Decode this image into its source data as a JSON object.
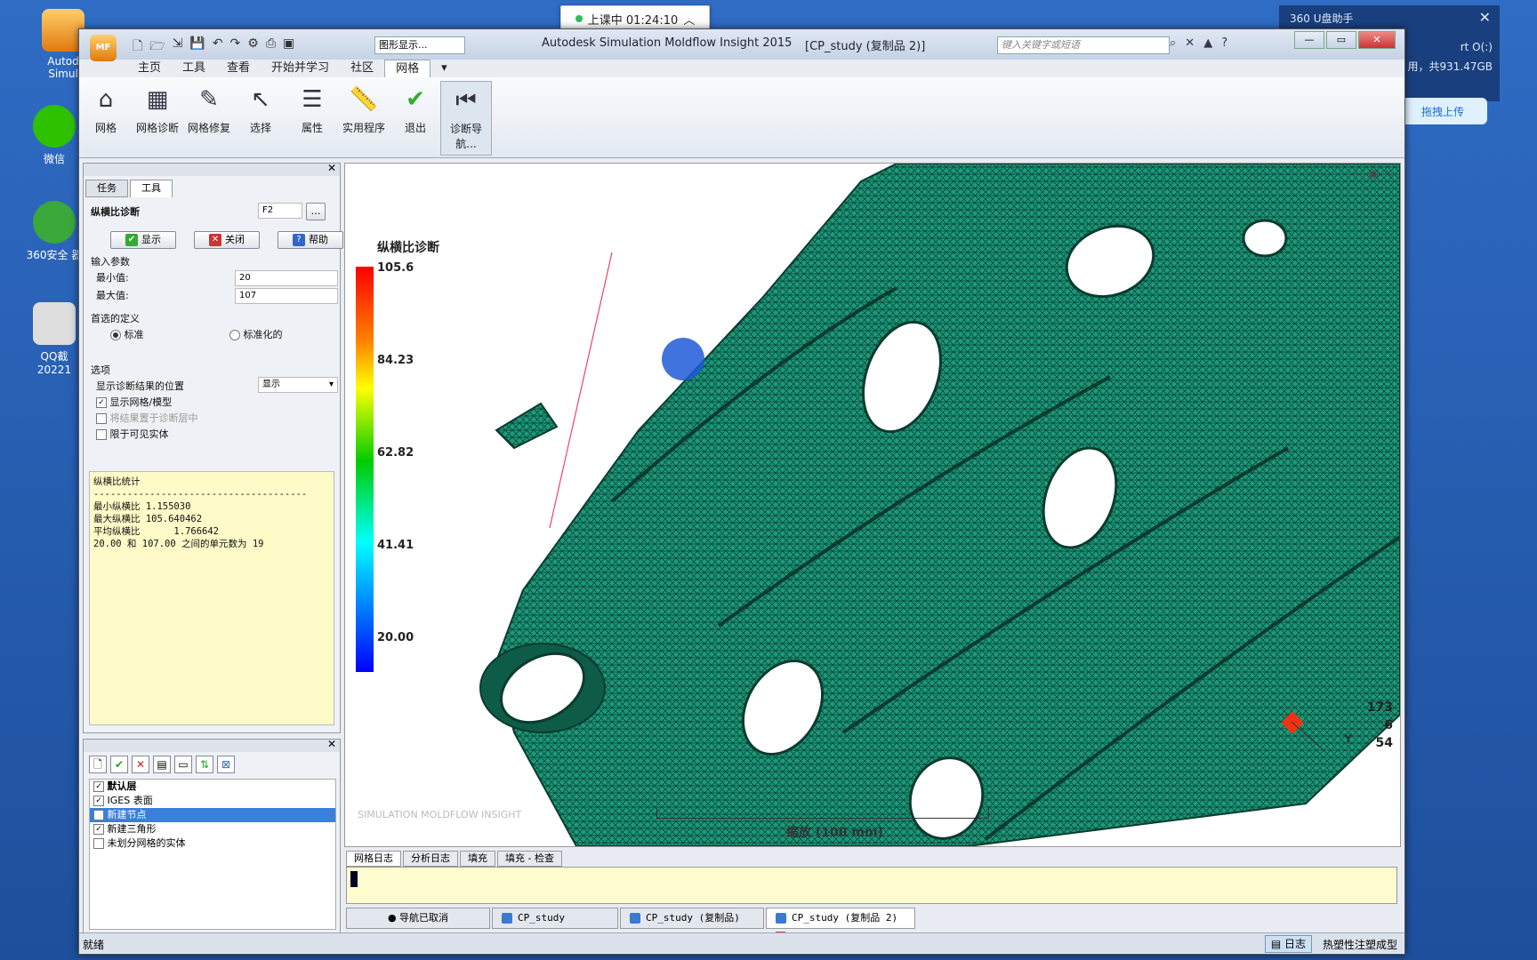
{
  "desktop": {
    "icons": [
      {
        "label": "Autod Simul"
      },
      {
        "label": "微信"
      },
      {
        "label": "360安全 器"
      },
      {
        "label": "QQ截 20221"
      }
    ]
  },
  "timer": {
    "label": "上课中 01:24:10"
  },
  "panel360": {
    "title": "360 U盘助手",
    "drive": "rt O(:)",
    "capacity": "用，共931.47GB",
    "upload": "拖拽上传"
  },
  "titlebar": {
    "app_badge": "MF",
    "display_select": "图形显示...",
    "title": "Autodesk Simulation Moldflow Insight 2015",
    "doc": "[CP_study (复制品 2)]",
    "search_placeholder": "键入关键字或短语"
  },
  "menu_tabs": [
    "主页",
    "工具",
    "查看",
    "开始并学习",
    "社区",
    "网格"
  ],
  "active_menu_tab": "网格",
  "ribbon": [
    {
      "label": "网格",
      "icon": "mesh-icon"
    },
    {
      "label": "网格诊断",
      "icon": "mesh-diagnose-icon"
    },
    {
      "label": "网格修复",
      "icon": "mesh-repair-icon"
    },
    {
      "label": "选择",
      "icon": "cursor-icon"
    },
    {
      "label": "属性",
      "icon": "properties-icon"
    },
    {
      "label": "实用程序",
      "icon": "ruler-icon"
    },
    {
      "label": "退出",
      "icon": "check-icon"
    },
    {
      "label": "诊断导航...",
      "icon": "navigator-icon"
    }
  ],
  "left_panel": {
    "tabs": [
      "任务",
      "工具"
    ],
    "tool_name": "纵横比诊断",
    "shortcut": "F2",
    "buttons": {
      "show": "显示",
      "close": "关闭",
      "help": "帮助"
    },
    "input_params": "输入参数",
    "min_label": "最小值:",
    "min_value": "20",
    "max_label": "最大值:",
    "max_value": "107",
    "preferred_def": "首选的定义",
    "radio_standard": "标准",
    "radio_normalized": "标准化的",
    "options": "选项",
    "show_location": "显示诊断结果的位置",
    "show_location_value": "显示",
    "cb_show_mesh": "显示网格/模型",
    "cb_put_layer": "将结果置于诊断层中",
    "cb_visible_only": "限于可见实体",
    "stats_text": "纵横比统计\n--------------------------------------\n最小纵横比 1.155030\n最大纵横比 105.640462\n平均纵横比      1.766642\n20.00 和 107.00 之间的单元数为 19"
  },
  "layers": [
    {
      "label": "默认层",
      "checked": true
    },
    {
      "label": "IGES 表面",
      "checked": true
    },
    {
      "label": "新建节点",
      "checked": false,
      "selected": true
    },
    {
      "label": "新建三角形",
      "checked": true
    },
    {
      "label": "未划分网格的实体",
      "checked": false
    }
  ],
  "viewport": {
    "legend_title": "纵横比诊断",
    "legend_values": [
      "105.6",
      "84.23",
      "62.82",
      "41.41",
      "20.00"
    ],
    "scale_label": "缩放 (100 mm)",
    "watermark": "SIMULATION MOLDFLOW INSIGHT",
    "axis_numbers": [
      "173",
      "6",
      "54"
    ],
    "axis_label": "Y"
  },
  "log_tabs": [
    "网格日志",
    "分析日志",
    "填充",
    "填充 - 检查"
  ],
  "doc_tabs": [
    "导航已取消",
    "CP_study",
    "CP_study (复制品)",
    "CP_study (复制品 2)"
  ],
  "status": {
    "left": "就绪",
    "log": "日志",
    "right": "热塑性注塑成型"
  },
  "colors": {
    "mesh": "#1a9a7a",
    "ribbon_bg": "#eef2f7",
    "stats_bg": "#fffbc8"
  }
}
